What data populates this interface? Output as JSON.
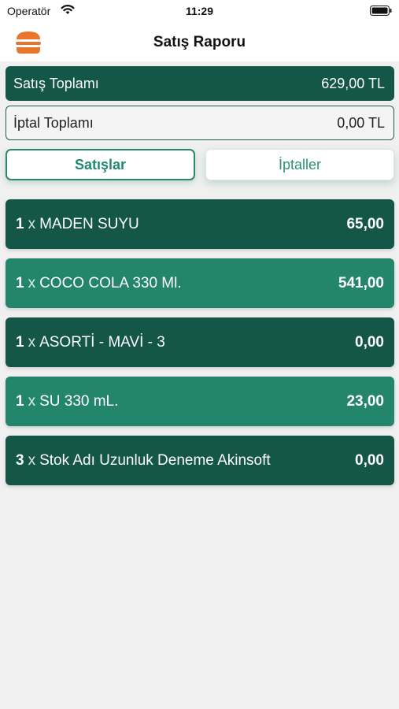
{
  "status_bar": {
    "carrier": "Operatör",
    "time": "11:29"
  },
  "nav": {
    "title": "Satış Raporu",
    "menu_icon": "burger-menu-icon"
  },
  "totals": {
    "sales_label": "Satış Toplamı",
    "sales_value": "629,00 TL",
    "cancel_label": "İptal Toplamı",
    "cancel_value": "0,00 TL"
  },
  "tabs": {
    "sales": "Satışlar",
    "cancels": "İptaller",
    "active": "sales"
  },
  "items": [
    {
      "qty": "1",
      "x": "x",
      "name": "MADEN SUYU",
      "amount": "65,00"
    },
    {
      "qty": "1",
      "x": "x",
      "name": "COCO COLA 330 Ml.",
      "amount": "541,00"
    },
    {
      "qty": "1",
      "x": "x",
      "name": "ASORTİ - MAVİ - 3",
      "amount": "0,00"
    },
    {
      "qty": "1",
      "x": "x",
      "name": "SU 330 mL.",
      "amount": "23,00"
    },
    {
      "qty": "3",
      "x": "x",
      "name": "Stok Adı Uzunluk Deneme Akinsoft",
      "amount": "0,00"
    }
  ],
  "colors": {
    "dark_row": "#145647",
    "light_row": "#23866c",
    "accent": "#1e8a6f",
    "menu_icon": "#e8772e"
  }
}
